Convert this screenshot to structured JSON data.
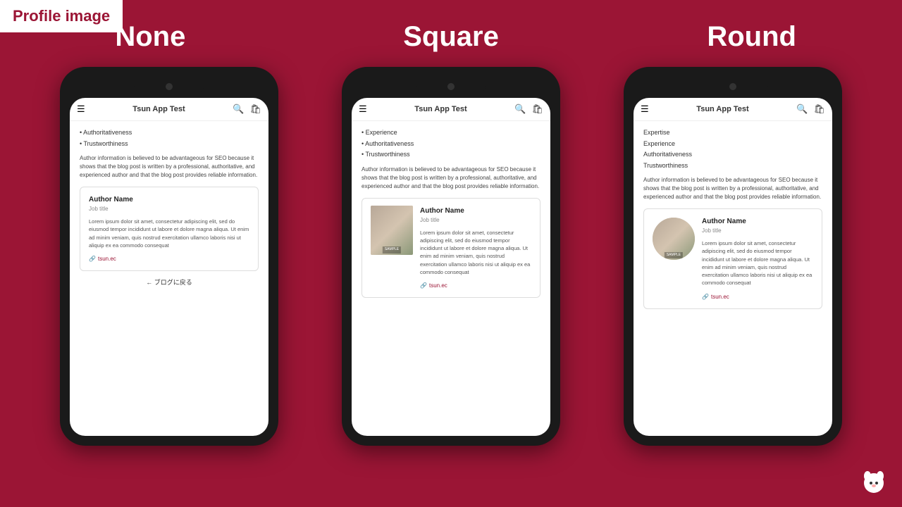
{
  "badge": {
    "text": "Profile image"
  },
  "columns": {
    "none_label": "None",
    "square_label": "Square",
    "round_label": "Round"
  },
  "app_bar": {
    "title": "Tsun App Test"
  },
  "phone_none": {
    "bullet_items": [
      "Authoritativeness",
      "Trustworthiness"
    ],
    "seo_text": "Author information is believed to be advantageous for SEO because it shows that the blog post is written by a professional, authoritative, and experienced author and that the blog post provides reliable information.",
    "author_name": "Author Name",
    "author_job": "Job title",
    "author_bio": "Lorem ipsum dolor sit amet, consectetur adipiscing elit, sed do eiusmod tempor incididunt ut labore et dolore magna aliqua.\nUt enim ad minim veniam, quis nostrud exercitation ullamco laboris nisi ut aliquip ex ea commodo consequat",
    "author_link": "tsun.ec",
    "back_text": "← ブログに戻る"
  },
  "phone_square": {
    "bullet_items": [
      "Experience",
      "Authoritativeness",
      "Trustworthiness"
    ],
    "seo_text": "Author information is believed to be advantageous for SEO because it shows that the blog post is written by a professional, authoritative, and experienced author and that the blog post provides reliable information.",
    "author_name": "Author Name",
    "author_job": "Job title",
    "author_bio": "Lorem ipsum dolor sit amet, consectetur adipiscing elit, sed do eiusmod tempor incididunt ut labore et dolore magna aliqua.\nUt enim ad minim veniam, quis nostrud exercitation ullamco laboris nisi ut aliquip ex ea commodo consequat",
    "author_link": "tsun.ec"
  },
  "phone_round": {
    "plain_items": [
      "Expertise",
      "Experience",
      "Authoritativeness",
      "Trustworthiness"
    ],
    "seo_text": "Author information is believed to be advantageous for SEO because it shows that the blog post is written by a professional, authoritative, and experienced author and that the blog post provides reliable information.",
    "author_name": "Author Name",
    "author_job": "Job title",
    "author_bio": "Lorem ipsum dolor sit amet, consectetur adipiscing elit, sed do eiusmod tempor incididunt ut labore et dolore magna aliqua.\nUt enim ad minim veniam, quis nostrud exercitation ullamco laboris nisi ut aliquip ex ea commodo consequat",
    "author_link": "tsun.ec"
  },
  "colors": {
    "brand": "#9b1535",
    "link": "#9b1535"
  }
}
